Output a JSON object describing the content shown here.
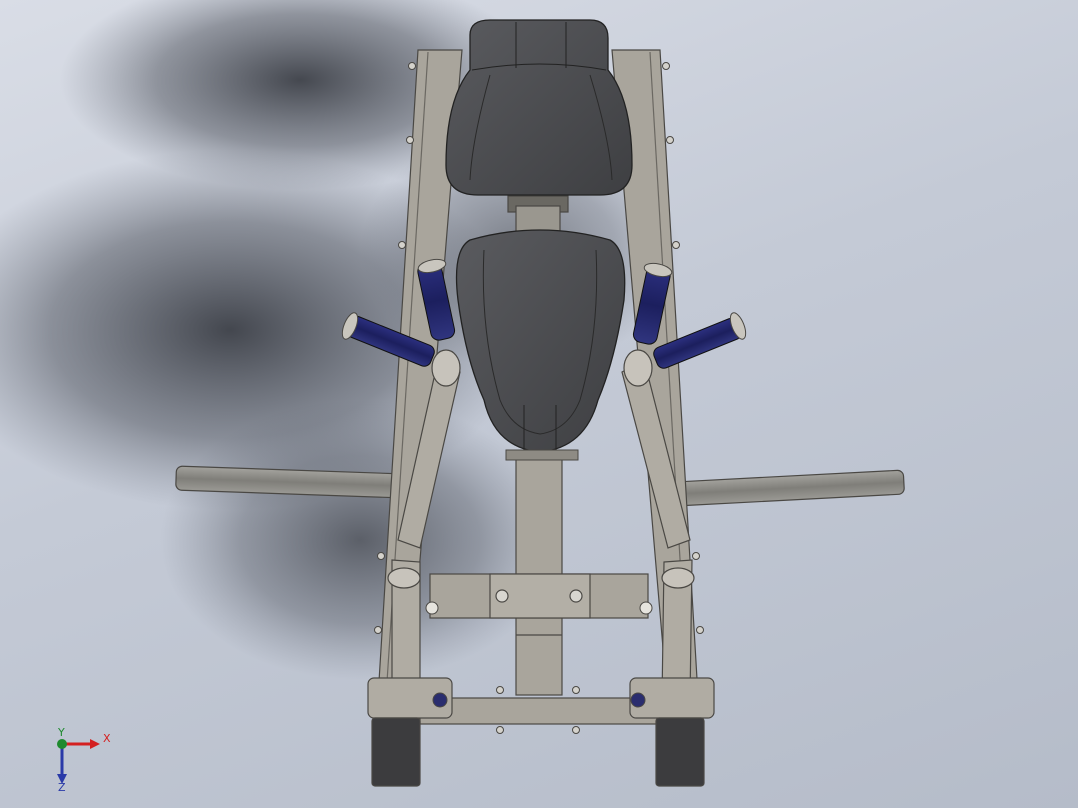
{
  "app": {
    "view": "cad-3d-model-viewport"
  },
  "model": {
    "name": "",
    "colors": {
      "frame": "#a9a59c",
      "frame_edge": "#4a4844",
      "upholstery": "#4a4b4e",
      "grip": "#1f2366",
      "bar": "#8e8d88"
    }
  },
  "triad": {
    "x_label": "X",
    "y_label": "Y",
    "z_label": "Z",
    "x_color": "#d42020",
    "y_color": "#1e8a2e",
    "z_color": "#2a3aa8"
  }
}
